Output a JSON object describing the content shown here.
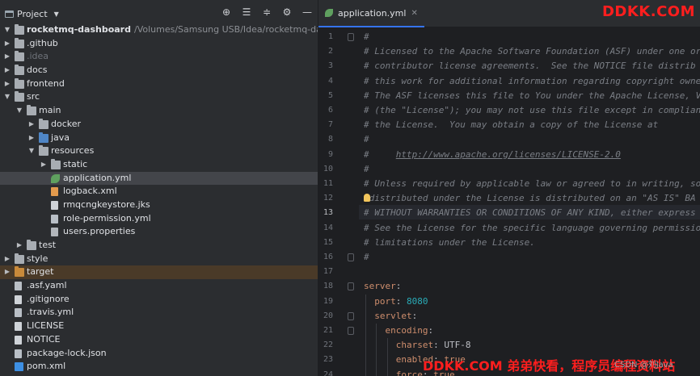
{
  "project_panel": {
    "title": "Project",
    "tools": [
      "crosshair-icon",
      "collapse-all-icon",
      "expand-all-icon",
      "gear-icon",
      "minimize-icon"
    ],
    "tree": [
      {
        "label": "rocketmq-dashboard",
        "path": "/Volumes/Samsung USB/Idea/rocketmq-dashboard",
        "depth": 0,
        "arrow": "down",
        "icon": "folder",
        "bold": true
      },
      {
        "label": ".github",
        "depth": 0,
        "arrow": "right",
        "icon": "folder"
      },
      {
        "label": ".idea",
        "depth": 0,
        "arrow": "right",
        "icon": "folder",
        "dim": true
      },
      {
        "label": "docs",
        "depth": 0,
        "arrow": "right",
        "icon": "folder"
      },
      {
        "label": "frontend",
        "depth": 0,
        "arrow": "right",
        "icon": "folder"
      },
      {
        "label": "src",
        "depth": 0,
        "arrow": "down",
        "icon": "folder"
      },
      {
        "label": "main",
        "depth": 1,
        "arrow": "down",
        "icon": "folder"
      },
      {
        "label": "docker",
        "depth": 2,
        "arrow": "right",
        "icon": "folder"
      },
      {
        "label": "java",
        "depth": 2,
        "arrow": "right",
        "icon": "folder-blue"
      },
      {
        "label": "resources",
        "depth": 2,
        "arrow": "down",
        "icon": "folder-res"
      },
      {
        "label": "static",
        "depth": 3,
        "arrow": "right",
        "icon": "folder"
      },
      {
        "label": "application.yml",
        "depth": 3,
        "arrow": "",
        "icon": "leaf",
        "selected": true
      },
      {
        "label": "logback.xml",
        "depth": 3,
        "arrow": "",
        "icon": "xml"
      },
      {
        "label": "rmqcngkeystore.jks",
        "depth": 3,
        "arrow": "",
        "icon": "file"
      },
      {
        "label": "role-permission.yml",
        "depth": 3,
        "arrow": "",
        "icon": "yml"
      },
      {
        "label": "users.properties",
        "depth": 3,
        "arrow": "",
        "icon": "props"
      },
      {
        "label": "test",
        "depth": 1,
        "arrow": "right",
        "icon": "folder"
      },
      {
        "label": "style",
        "depth": 0,
        "arrow": "right",
        "icon": "folder"
      },
      {
        "label": "target",
        "depth": 0,
        "arrow": "right",
        "icon": "folder-orange",
        "target": true
      },
      {
        "label": ".asf.yaml",
        "depth": 0,
        "arrow": "",
        "icon": "yml"
      },
      {
        "label": ".gitignore",
        "depth": 0,
        "arrow": "",
        "icon": "file"
      },
      {
        "label": ".travis.yml",
        "depth": 0,
        "arrow": "",
        "icon": "yml"
      },
      {
        "label": "LICENSE",
        "depth": 0,
        "arrow": "",
        "icon": "file"
      },
      {
        "label": "NOTICE",
        "depth": 0,
        "arrow": "",
        "icon": "file"
      },
      {
        "label": "package-lock.json",
        "depth": 0,
        "arrow": "",
        "icon": "json"
      },
      {
        "label": "pom.xml",
        "depth": 0,
        "arrow": "",
        "icon": "mvn"
      }
    ]
  },
  "editor": {
    "tab_label": "application.yml",
    "current_line": 13,
    "lines": [
      [
        [
          "cmt",
          "#"
        ]
      ],
      [
        [
          "cmt",
          "# Licensed to the Apache Software Foundation (ASF) under one or"
        ]
      ],
      [
        [
          "cmt",
          "# contributor license agreements.  See the NOTICE file distrib"
        ]
      ],
      [
        [
          "cmt",
          "# this work for additional information regarding copyright owne"
        ]
      ],
      [
        [
          "cmt",
          "# The ASF licenses this file to You under the Apache License, V"
        ]
      ],
      [
        [
          "cmt",
          "# (the \"License\"); you may not use this file except in complian"
        ]
      ],
      [
        [
          "cmt",
          "# the License.  You may obtain a copy of the License at"
        ]
      ],
      [
        [
          "cmt",
          "#"
        ]
      ],
      [
        [
          "cmt",
          "#     "
        ],
        [
          "url",
          "http://www.apache.org/licenses/LICENSE-2.0"
        ]
      ],
      [
        [
          "cmt",
          "#"
        ]
      ],
      [
        [
          "cmt",
          "# Unless required by applicable law or agreed to in writing, so"
        ]
      ],
      [
        [
          "cmt",
          "#distributed under the License is distributed on an \"AS IS\" BA"
        ]
      ],
      [
        [
          "cmt",
          "# WITHOUT WARRANTIES OR CONDITIONS OF ANY KIND, either express"
        ]
      ],
      [
        [
          "cmt",
          "# See the License for the specific language governing permissio"
        ]
      ],
      [
        [
          "cmt",
          "# limitations under the License."
        ]
      ],
      [
        [
          "cmt",
          "#"
        ]
      ],
      [],
      [
        [
          "key",
          "server"
        ],
        [
          "val",
          ":"
        ]
      ],
      [
        [
          "val",
          "  "
        ],
        [
          "key",
          "port"
        ],
        [
          "val",
          ": "
        ],
        [
          "num",
          "8080"
        ]
      ],
      [
        [
          "val",
          "  "
        ],
        [
          "key",
          "servlet"
        ],
        [
          "val",
          ":"
        ]
      ],
      [
        [
          "val",
          "    "
        ],
        [
          "key",
          "encoding"
        ],
        [
          "val",
          ":"
        ]
      ],
      [
        [
          "val",
          "      "
        ],
        [
          "key",
          "charset"
        ],
        [
          "val",
          ": "
        ],
        [
          "val",
          "UTF-8"
        ]
      ],
      [
        [
          "val",
          "      "
        ],
        [
          "key",
          "enabled"
        ],
        [
          "val",
          ": "
        ],
        [
          "kw",
          "true"
        ]
      ],
      [
        [
          "val",
          "      "
        ],
        [
          "key",
          "force"
        ],
        [
          "val",
          ": "
        ],
        [
          "kw",
          "true"
        ]
      ]
    ]
  },
  "watermarks": {
    "top_right": "DDKK.COM",
    "bottom": "DDKK.COM 弟弟快看，程序员编程资料站",
    "csdn": "CSDN @刘Java"
  }
}
